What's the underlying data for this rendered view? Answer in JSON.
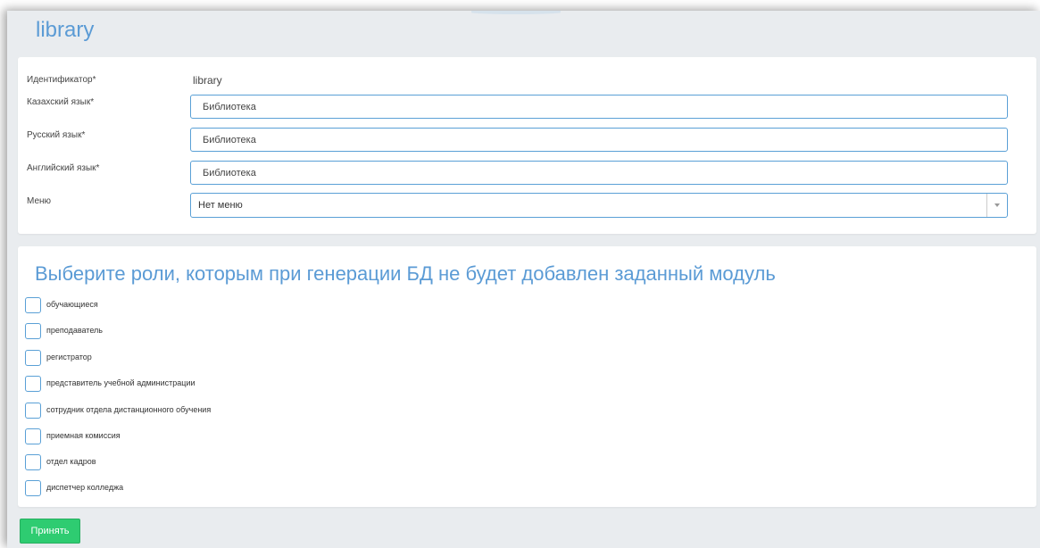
{
  "page": {
    "title": "library"
  },
  "fields": {
    "identifier": {
      "label": "Идентификатор*",
      "value": "library"
    },
    "kazakh": {
      "label": "Казахский язык*",
      "value": "Библиотека"
    },
    "russian": {
      "label": "Русский язык*",
      "value": "Библиотека"
    },
    "english": {
      "label": "Английский язык*",
      "value": "Библиотека"
    },
    "menu": {
      "label": "Меню",
      "value": "Нет меню"
    }
  },
  "roles": {
    "title": "Выберите роли, которым при генерации БД не будет добавлен заданный модуль",
    "items": [
      {
        "label": "обучающиеся",
        "checked": false
      },
      {
        "label": "преподаватель",
        "checked": false
      },
      {
        "label": "регистратор",
        "checked": false
      },
      {
        "label": "представитель учебной администрации",
        "checked": false
      },
      {
        "label": "сотрудник отдела дистанционного обучения",
        "checked": false
      },
      {
        "label": "приемная комиссия",
        "checked": false
      },
      {
        "label": "отдел кадров",
        "checked": false
      },
      {
        "label": "диспетчер колледжа",
        "checked": false
      }
    ]
  },
  "actions": {
    "submit_label": "Принять"
  },
  "colors": {
    "accent": "#5b9bd5",
    "submit": "#2ecc71",
    "background": "#e9ecef"
  }
}
